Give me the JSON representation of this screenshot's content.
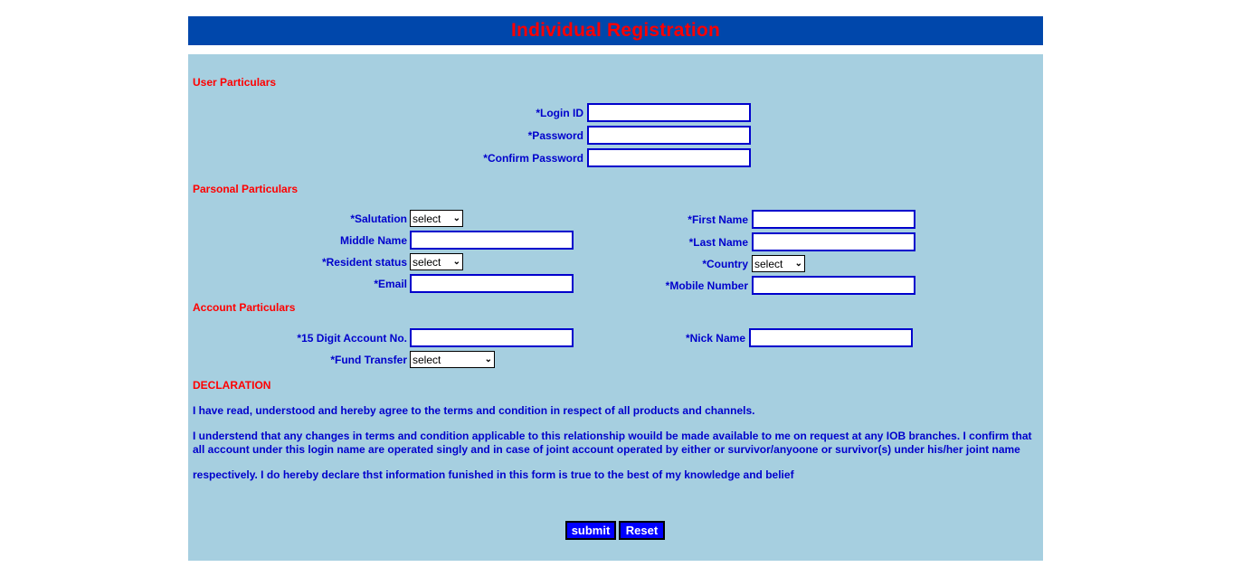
{
  "header": {
    "title": "Individual Registration"
  },
  "sections": {
    "user": "User Particulars",
    "personal": "Parsonal Particulars",
    "account": "Account Particulars",
    "declaration": "DECLARATION"
  },
  "user_particulars": {
    "login_id_label": "*Login ID",
    "password_label": "*Password",
    "confirm_password_label": "*Confirm Password"
  },
  "personal_particulars": {
    "salutation_label": "*Salutation",
    "salutation_value": "select",
    "middle_name_label": "Middle Name",
    "resident_status_label": "*Resident status",
    "resident_status_value": "select",
    "email_label": "*Email",
    "first_name_label": "*First Name",
    "last_name_label": "*Last Name",
    "country_label": "*Country",
    "country_value": "select",
    "mobile_label": "*Mobile Number"
  },
  "account_particulars": {
    "account_no_label": "*15 Digit Account No.",
    "fund_transfer_label": "*Fund Transfer",
    "fund_transfer_value": "select",
    "nick_name_label": "*Nick Name"
  },
  "declaration": {
    "para1": "I have read, understood and hereby agree to the terms and condition in respect of all products and channels.",
    "para2_line1": "I understend that any changes in terms and condition applicable to this relationship wouild be made available to me on request at any IOB branches. I confirm that",
    "para2_line2": "all account under this login name are operated singly and in case of joint account operated by either or survivor/anyoone or survivor(s) under his/her joint name",
    "para3": "respectively. I do hereby declare thst information funished in this form is true to the best of my knowledge and belief"
  },
  "buttons": {
    "submit": "submit",
    "reset": "Reset"
  },
  "colors": {
    "header_bg": "#0047ab",
    "panel_bg": "#a6cfe0",
    "section_text": "#ff0000",
    "label_text": "#0000cc",
    "button_bg": "#0000ff"
  }
}
